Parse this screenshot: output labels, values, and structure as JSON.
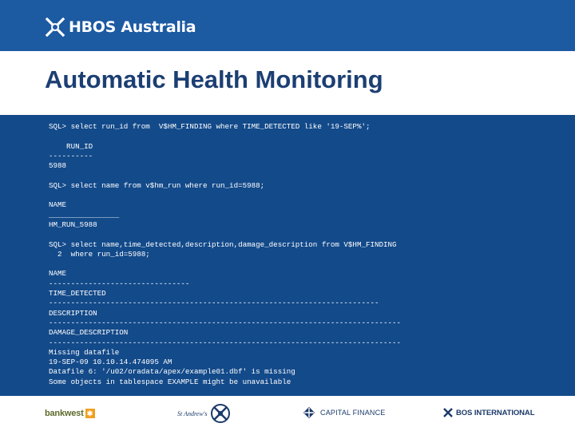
{
  "header": {
    "brand_name": "HBOS Australia",
    "brand_icon": "hbos-saltire-icon",
    "background_color": "#1c5aa2"
  },
  "slide": {
    "title": "Automatic Health Monitoring",
    "title_color": "#1c3f73"
  },
  "code_panel": {
    "background_color": "#134a8a",
    "text": "SQL> select run_id from  V$HM_FINDING where TIME_DETECTED like '19-SEP%';\n\n    RUN_ID\n----------\n5988\n\nSQL> select name from v$hm_run where run_id=5988;\n\nNAME\n________________\nHM_RUN_5988\n\nSQL> select name,time_detected,description,damage_description from V$HM_FINDING\n  2  where run_id=5988;\n\nNAME\n--------------------------------\nTIME_DETECTED\n---------------------------------------------------------------------------\nDESCRIPTION\n--------------------------------------------------------------------------------\nDAMAGE_DESCRIPTION\n--------------------------------------------------------------------------------\nMissing datafile\n19-SEP-09 10.10.14.474095 AM\nDatafile 6: '/u02/oradata/apex/example01.dbf' is missing\nSome objects in tablespace EXAMPLE might be unavailable"
  },
  "footer": {
    "logos": {
      "bankwest": "bankwest",
      "standrews": "St Andrew's",
      "capital_finance": "CAPITAL FINANCE",
      "bos_international": "BOS INTERNATIONAL"
    }
  }
}
